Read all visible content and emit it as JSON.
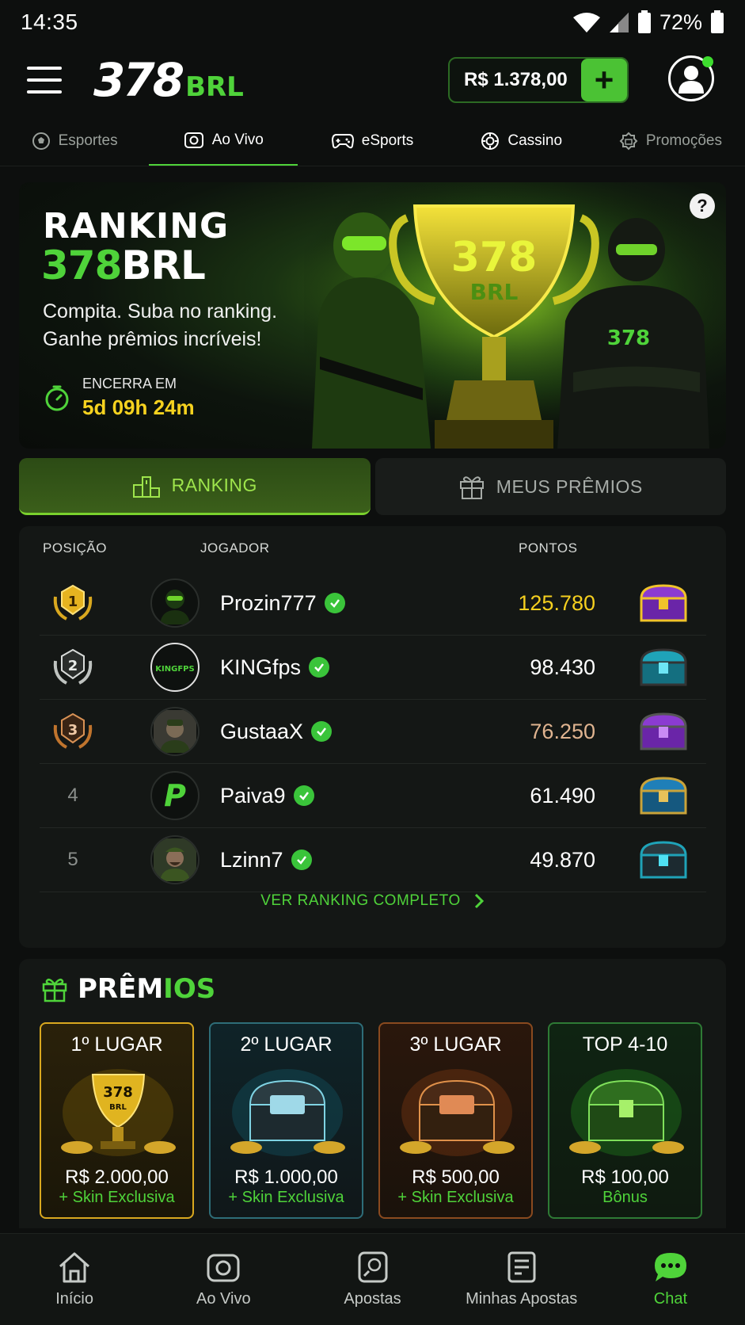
{
  "status_bar": {
    "time": "14:35",
    "battery": "72%"
  },
  "header": {
    "logo_number": "378",
    "logo_suffix": "BRL",
    "balance": "R$ 1.378,00",
    "add_label": "+"
  },
  "nav_tabs": [
    {
      "label": "Esportes",
      "icon": "soccer-ball-icon"
    },
    {
      "label": "Ao Vivo",
      "icon": "live-camera-icon"
    },
    {
      "label": "eSports",
      "icon": "gamepad-icon"
    },
    {
      "label": "Cassino",
      "icon": "casino-chip-icon"
    },
    {
      "label": "Promoções",
      "icon": "gift-badge-icon"
    }
  ],
  "banner": {
    "title_line1": "RANKING",
    "title_num": "378",
    "title_brl": "BRL",
    "subtitle": "Compita. Suba no ranking. Ganhe prêmios incríveis!",
    "timer_label": "ENCERRA EM",
    "timer_value": "5d 09h 24m",
    "trophy_text_num": "378",
    "trophy_text_brl": "BRL",
    "shirt_text": "378",
    "help": "?"
  },
  "segment_tabs": {
    "ranking": "RANKING",
    "prizes": "MEUS PRÊMIOS"
  },
  "ranking": {
    "columns": {
      "position": "POSIÇÃO",
      "player": "JOGADOR",
      "points": "PONTOS"
    },
    "rows": [
      {
        "position": "1",
        "name": "Prozin777",
        "points": "125.780",
        "points_color": "#f5cf1f",
        "chest_color": "#8b3bd1"
      },
      {
        "position": "2",
        "name": "KINGfps",
        "points": "98.430",
        "points_color": "#ffffff",
        "chest_color": "#1fa3b8",
        "avatar_text": "KINGFPS"
      },
      {
        "position": "3",
        "name": "GustaaX",
        "points": "76.250",
        "points_color": "#e0b490",
        "chest_color": "#8b3bd1"
      },
      {
        "position": "4",
        "name": "Paiva9",
        "points": "61.490",
        "points_color": "#ffffff",
        "chest_color": "#1f7fb8",
        "avatar_text": "P"
      },
      {
        "position": "5",
        "name": "Lzinn7",
        "points": "49.870",
        "points_color": "#ffffff",
        "chest_color": "#1fa3b8"
      }
    ],
    "see_all": "VER RANKING COMPLETO"
  },
  "prizes": {
    "title_a": "PRÊM",
    "title_b": "IOS",
    "cards": [
      {
        "title": "1º LUGAR",
        "amount": "R$ 2.000,00",
        "extra": "+ Skin Exclusiva",
        "trophy_num": "378",
        "trophy_brl": "BRL",
        "accent": "#d9a81f"
      },
      {
        "title": "2º LUGAR",
        "amount": "R$ 1.000,00",
        "extra": "+ Skin Exclusiva",
        "accent": "#3c9db0"
      },
      {
        "title": "3º LUGAR",
        "amount": "R$ 500,00",
        "extra": "+ Skin Exclusiva",
        "accent": "#c0742d"
      },
      {
        "title": "TOP 4-10",
        "amount": "R$ 100,00",
        "extra": "Bônus",
        "accent": "#2e8a35"
      }
    ]
  },
  "bottom_nav": [
    {
      "label": "Início",
      "icon": "home-icon"
    },
    {
      "label": "Ao Vivo",
      "icon": "live-camera-icon"
    },
    {
      "label": "Apostas",
      "icon": "bet-ticket-icon"
    },
    {
      "label": "Minhas Apostas",
      "icon": "my-bets-icon"
    },
    {
      "label": "Chat",
      "icon": "chat-icon"
    }
  ],
  "colors": {
    "accent": "#4fd33a",
    "gold": "#f5cf1f",
    "background": "#0d0f0e"
  }
}
